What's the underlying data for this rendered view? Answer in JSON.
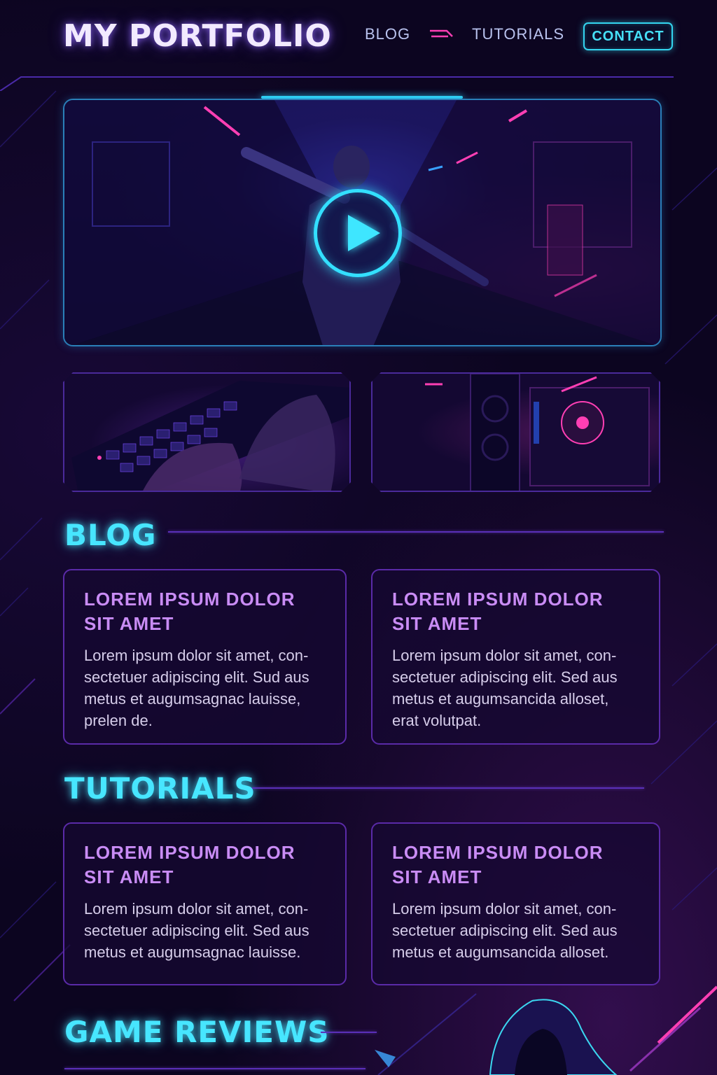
{
  "header": {
    "logo": "MY PORTFOLIO",
    "nav": {
      "blog": "BLOG",
      "tutorials": "TUTORIALS",
      "contact": "CONTACT"
    }
  },
  "hero": {
    "media": "video-thumbnail",
    "icon": "play-icon"
  },
  "sections": {
    "blog": {
      "title": "BLOG",
      "cards": [
        {
          "title": "LOREM IPSUM DOLOR SIT AMET",
          "body": "Lorem ipsum dolor sit amet, con-sectetuer adipiscing elit. Sud aus metus et augumsagnac lauisse, prelen de."
        },
        {
          "title": "LOREM IPSUM DOLOR SIT AMET",
          "body": "Lorem ipsum dolor sit amet, con-sectetuer adipiscing elit. Sed aus metus et augumsancida alloset, erat volutpat."
        }
      ]
    },
    "tutorials": {
      "title": "TUTORIALS",
      "cards": [
        {
          "title": "LOREM IPSUM DOLOR SIT AMET",
          "body": "Lorem ipsum dolor sit amet, con-sectetuer adipiscing elit. Sed aus metus et augumsagnac lauisse."
        },
        {
          "title": "LOREM IPSUM DOLOR SIT AMET",
          "body": "Lorem ipsum dolor sit amet, con-sectetuer adipiscing elit. Sed aus metus et augumsancida alloset."
        }
      ]
    },
    "reviews": {
      "title": "GAME REVIEWS"
    }
  },
  "colors": {
    "background": "#0c0520",
    "accent_cyan": "#47e6ff",
    "accent_purple": "#c98cf5",
    "border_purple": "#5a2aa8",
    "accent_pink": "#ff3fb4"
  }
}
